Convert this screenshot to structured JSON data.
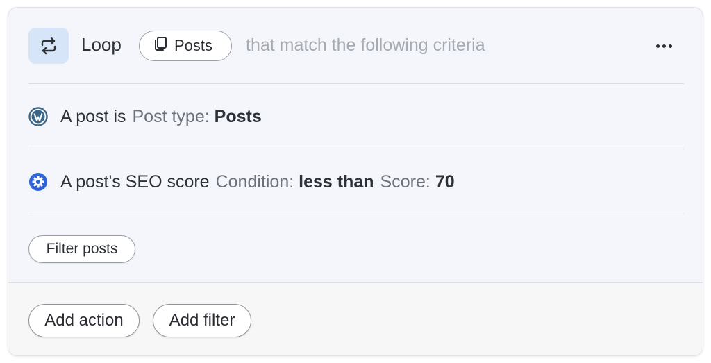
{
  "loop_block": {
    "icon": "loop-arrows-icon",
    "label": "Loop",
    "source_chip": {
      "icon": "copy-pages-icon",
      "label": "Posts"
    },
    "criteria_text": "that match the following criteria",
    "more_icon": "more-horizontal-icon"
  },
  "conditions": [
    {
      "icon": "wordpress-logo-icon",
      "text": "A post is",
      "params": [
        {
          "label": "Post type:",
          "value": "Posts"
        }
      ]
    },
    {
      "icon": "seo-gear-badge-icon",
      "text": "A post's SEO score",
      "params": [
        {
          "label": "Condition:",
          "value": "less than"
        },
        {
          "label": "Score:",
          "value": "70"
        }
      ]
    }
  ],
  "filter_posts_label": "Filter posts",
  "footer": {
    "add_action_label": "Add action",
    "add_filter_label": "Add filter"
  },
  "colors": {
    "card_background": "#f4f6fc",
    "icon_tile": "#d6e5f8",
    "seo_badge": "#2f63d8",
    "wordpress_logo": "#3c6788",
    "muted_text": "#a6abb3"
  }
}
